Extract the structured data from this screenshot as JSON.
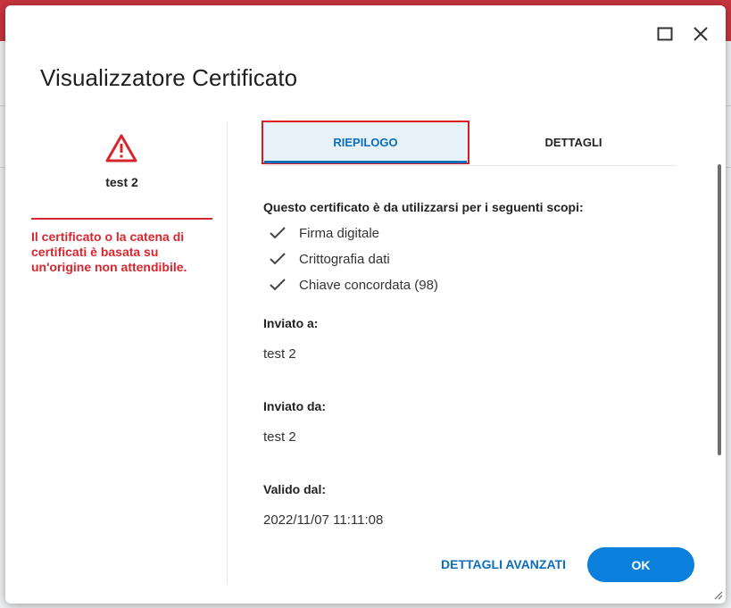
{
  "window": {
    "title": "Visualizzatore Certificato",
    "maximize_icon": "maximize-icon",
    "close_icon": "close-icon"
  },
  "left_panel": {
    "warning_icon": "warning-triangle-icon",
    "cert_name": "test 2",
    "warning_text": "Il certificato o la catena di certificati è basata su un'origine non attendibile.",
    "warning_color": "#d7262e"
  },
  "tabs": [
    {
      "label": "RIEPILOGO",
      "active": true
    },
    {
      "label": "DETTAGLI",
      "active": false
    }
  ],
  "summary": {
    "scopes_title": "Questo certificato è da utilizzarsi per i seguenti scopi:",
    "scopes": [
      "Firma digitale",
      "Crittografia dati",
      "Chiave concordata (98)"
    ],
    "issued_to_label": "Inviato a:",
    "issued_to_value": "test 2",
    "issued_by_label": "Inviato da:",
    "issued_by_value": "test 2",
    "valid_from_label": "Valido dal:",
    "valid_from_value": "2022/11/07 11:11:08"
  },
  "footer": {
    "advanced_label": "DETTAGLI AVANZATI",
    "ok_label": "OK"
  },
  "colors": {
    "accent": "#0a7fdc",
    "link": "#0a6ebd",
    "highlight_border": "#e0191f"
  }
}
